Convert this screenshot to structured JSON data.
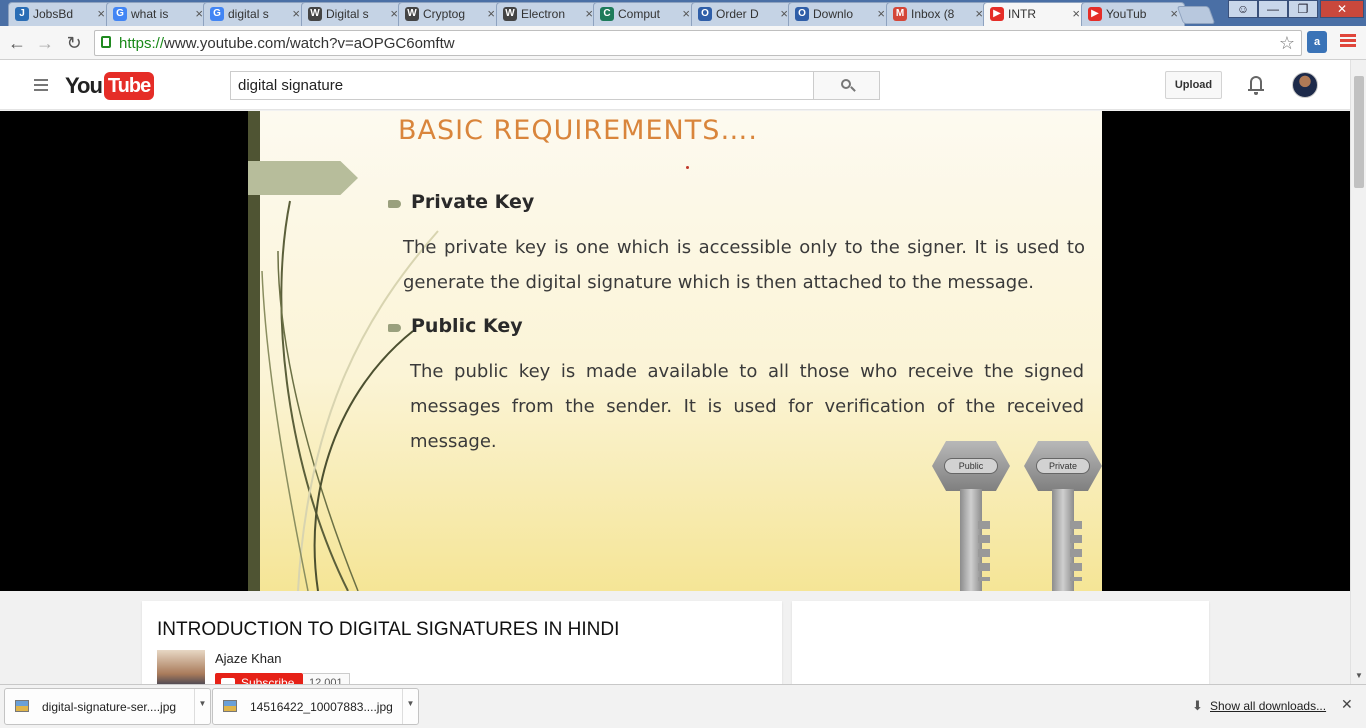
{
  "browser": {
    "tabs": [
      {
        "label": "JobsBd",
        "fav": "jobsbd-icon",
        "color": "#2a6db5",
        "glyph": "J"
      },
      {
        "label": "what is",
        "fav": "google-icon",
        "color": "#4285f4",
        "glyph": "G"
      },
      {
        "label": "digital s",
        "fav": "google-icon",
        "color": "#4285f4",
        "glyph": "G"
      },
      {
        "label": "Digital s",
        "fav": "wikipedia-icon",
        "color": "#444444",
        "glyph": "W"
      },
      {
        "label": "Cryptog",
        "fav": "wikipedia-icon",
        "color": "#444444",
        "glyph": "W"
      },
      {
        "label": "Electron",
        "fav": "wikipedia-icon",
        "color": "#444444",
        "glyph": "W"
      },
      {
        "label": "Comput",
        "fav": "classroom-icon",
        "color": "#1e7b5a",
        "glyph": "C"
      },
      {
        "label": "Order D",
        "fav": "otn-icon",
        "color": "#2f5ea8",
        "glyph": "O"
      },
      {
        "label": "Downlo",
        "fav": "otn-icon",
        "color": "#2f5ea8",
        "glyph": "O"
      },
      {
        "label": "Inbox (8",
        "fav": "gmail-icon",
        "color": "#d44638",
        "glyph": "M"
      },
      {
        "label": "INTR",
        "fav": "youtube-icon",
        "color": "#e52d27",
        "glyph": "▶",
        "active": true
      },
      {
        "label": "YouTub",
        "fav": "youtube-icon",
        "color": "#e52d27",
        "glyph": "▶"
      }
    ],
    "url_scheme": "https://",
    "url_rest": "www.youtube.com/watch?v=aOPGC6omftw"
  },
  "youtube": {
    "logo_you": "You",
    "logo_tube": "Tube",
    "search_value": "digital signature",
    "upload_label": "Upload"
  },
  "slide": {
    "title": "BASIC REQUIREMENTS….",
    "private_heading": "Private Key",
    "private_text": "The private key is one which is accessible only to the signer. It is used to generate the digital signature which is then attached to the message.",
    "public_heading": "Public Key",
    "public_text": "The public key is made available to all those who receive the signed messages from the sender. It is used for verification of the received message.",
    "key_public_tag": "Public",
    "key_private_tag": "Private"
  },
  "video": {
    "title": "INTRODUCTION TO DIGITAL SIGNATURES IN HINDI",
    "channel": "Ajaze Khan",
    "subscribe_label": "Subscribe",
    "subscriber_count": "12,001"
  },
  "downloads": {
    "items": [
      {
        "name": "digital-signature-ser....jpg"
      },
      {
        "name": "14516422_10007883....jpg"
      }
    ],
    "show_all": "Show all downloads..."
  }
}
